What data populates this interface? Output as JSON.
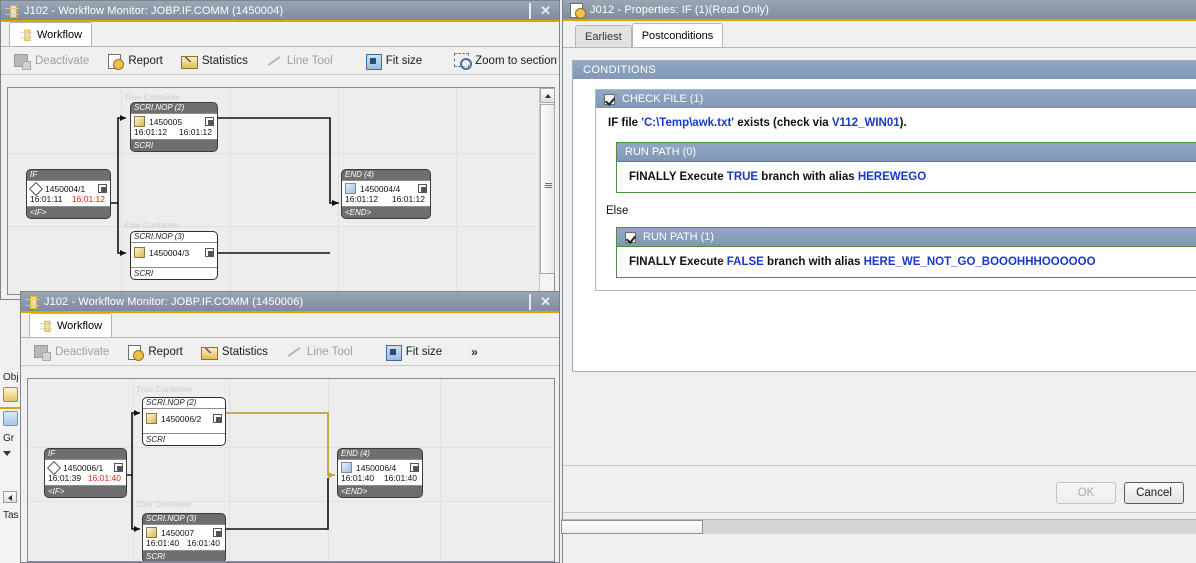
{
  "desktop": {
    "sidebar_fragments": [
      "Obj",
      "Gr",
      "Tas"
    ]
  },
  "window1": {
    "title": "J102 - Workflow Monitor: JOBP.IF.COMM (1450004)",
    "icon": "workflow-icon",
    "buttons": {
      "minimize": "minimize",
      "maximize": "maximize",
      "close": "close"
    },
    "tabs": [
      {
        "label": "Workflow",
        "active": true
      }
    ],
    "toolbar": [
      {
        "label": "Deactivate",
        "icon": "deactivate-icon",
        "disabled": true
      },
      {
        "label": "Report",
        "icon": "report-icon",
        "disabled": false
      },
      {
        "label": "Statistics",
        "icon": "statistics-icon",
        "disabled": false
      },
      {
        "label": "Line Tool",
        "icon": "line-tool-icon",
        "disabled": true
      },
      {
        "label": "Fit size",
        "icon": "fit-size-icon",
        "disabled": false
      },
      {
        "label": "Zoom to section",
        "icon": "zoom-to-section-icon",
        "disabled": false
      },
      {
        "label": "»",
        "icon": "overflow-icon",
        "disabled": false
      }
    ],
    "graph": {
      "container_labels": [
        "True Container",
        "Else Container"
      ],
      "nodes": [
        {
          "name": "if-node",
          "head": "IF",
          "id": "1450004/1",
          "start": "16:01:11",
          "end": "16:01:12",
          "end_red": true,
          "foot": "<IF>",
          "style": "gray",
          "icon": "if-diamond-icon"
        },
        {
          "name": "scri-nop-2-node",
          "head": "SCRI.NOP (2)",
          "id": "1450005",
          "start": "16:01:12",
          "end": "16:01:12",
          "end_red": false,
          "foot": "SCRI",
          "style": "gray",
          "icon": "script-icon"
        },
        {
          "name": "scri-nop-3-node",
          "head": "SCRI.NOP (3)",
          "id": "1450004/3",
          "start": "",
          "end": "",
          "end_red": false,
          "foot": "SCRI",
          "style": "white",
          "icon": "script-icon"
        },
        {
          "name": "end-node",
          "head": "END (4)",
          "id": "1450004/4",
          "start": "16:01:12",
          "end": "16:01:12",
          "end_red": false,
          "foot": "<END>",
          "style": "gray",
          "icon": "end-icon"
        }
      ]
    }
  },
  "window2": {
    "title": "J102 - Workflow Monitor: JOBP.IF.COMM (1450006)",
    "icon": "workflow-icon",
    "buttons": {
      "minimize": "minimize",
      "maximize": "maximize",
      "close": "close"
    },
    "tabs": [
      {
        "label": "Workflow",
        "active": true
      }
    ],
    "toolbar": [
      {
        "label": "Deactivate",
        "icon": "deactivate-icon",
        "disabled": true
      },
      {
        "label": "Report",
        "icon": "report-icon",
        "disabled": false
      },
      {
        "label": "Statistics",
        "icon": "statistics-icon",
        "disabled": false
      },
      {
        "label": "Line Tool",
        "icon": "line-tool-icon",
        "disabled": true
      },
      {
        "label": "Fit size",
        "icon": "fit-size-icon",
        "disabled": false
      },
      {
        "label": "»",
        "icon": "overflow-icon",
        "disabled": false
      }
    ],
    "graph": {
      "container_labels": [
        "True Container",
        "Else Container"
      ],
      "nodes": [
        {
          "name": "if-node",
          "head": "IF",
          "id": "1450006/1",
          "start": "16:01:39",
          "end": "16:01:40",
          "end_red": true,
          "foot": "<IF>",
          "style": "gray",
          "icon": "if-diamond-icon"
        },
        {
          "name": "scri-nop-2-node",
          "head": "SCRI.NOP (2)",
          "id": "1450006/2",
          "start": "",
          "end": "",
          "end_red": false,
          "foot": "SCRI",
          "style": "white",
          "icon": "script-icon"
        },
        {
          "name": "scri-nop-3-node",
          "head": "SCRI.NOP (3)",
          "id": "1450007",
          "start": "16:01:40",
          "end": "16:01:40",
          "end_red": false,
          "foot": "SCRI",
          "style": "gray",
          "icon": "script-icon"
        },
        {
          "name": "end-node",
          "head": "END (4)",
          "id": "1450006/4",
          "start": "16:01:40",
          "end": "16:01:40",
          "end_red": false,
          "foot": "<END>",
          "style": "gray",
          "icon": "end-icon"
        }
      ]
    }
  },
  "properties": {
    "title": "J012 - Properties: IF (1)(Read Only)",
    "icon": "properties-icon",
    "tabs": [
      {
        "label": "Earliest",
        "active": false
      },
      {
        "label": "Postconditions",
        "active": true
      }
    ],
    "section_header": "CONDITIONS",
    "check_file": {
      "header": "CHECK FILE (1)",
      "checked": true,
      "text_prefix": "IF file ",
      "path": "'C:\\Temp\\awk.txt'",
      "text_mid": " exists (check via ",
      "agent": "V112_WIN01",
      "text_suffix": ")."
    },
    "run_path_true": {
      "header": "RUN PATH (0)",
      "checked": false,
      "prefix": "FINALLY Execute ",
      "branch": "TRUE",
      "mid": " branch with alias ",
      "alias": "HEREWEGO"
    },
    "else_label": "Else",
    "run_path_false": {
      "header": "RUN PATH (1)",
      "checked": true,
      "prefix": "FINALLY Execute ",
      "branch": "FALSE",
      "mid": " branch with alias ",
      "alias": "HERE_WE_NOT_GO_BOOOHHHOOOOOO"
    },
    "footer": {
      "ok_label": "OK",
      "ok_disabled": true,
      "cancel_label": "Cancel"
    }
  },
  "colors": {
    "titlebar_accent": "#e0a400",
    "section_header_bg": "#7f97b7",
    "link_blue": "#1a39c8",
    "alert_red": "#e02020",
    "runpath_border": "#4e8f46",
    "connector_gold": "#c8a13a"
  }
}
